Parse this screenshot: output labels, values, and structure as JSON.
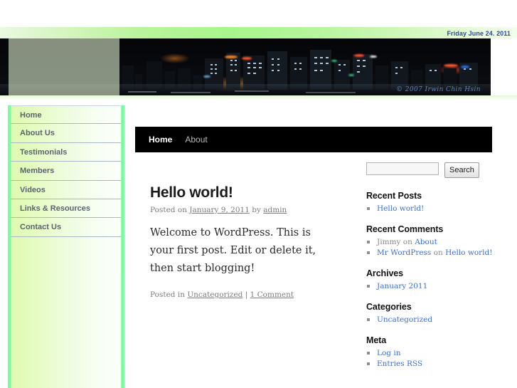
{
  "date_bar": {
    "text": "Friday June 24. 2011"
  },
  "header": {
    "watermark": "© 2007 Irwin Chin Hsin",
    "image_alt": "night-city-skyline"
  },
  "sidebar_menu": {
    "items": [
      {
        "label": "Home"
      },
      {
        "label": "About Us"
      },
      {
        "label": "Testimonials"
      },
      {
        "label": "Members"
      },
      {
        "label": "Videos"
      },
      {
        "label": "Links & Resources"
      },
      {
        "label": "Contact Us"
      }
    ]
  },
  "topnav": {
    "items": [
      {
        "label": "Home",
        "active": true
      },
      {
        "label": "About",
        "active": false
      }
    ]
  },
  "post": {
    "title": "Hello world!",
    "meta_prefix": "Posted on ",
    "meta_date": "January 9, 2011",
    "meta_by": " by ",
    "meta_author": "admin",
    "body": "Welcome to WordPress. This is your first post. Edit or delete it, then start blogging!",
    "footer_prefix": "Posted in ",
    "footer_category": "Uncategorized",
    "footer_sep": " | ",
    "footer_comments": "1 Comment"
  },
  "search": {
    "value": "",
    "placeholder": "",
    "button_label": "Search"
  },
  "widgets": [
    {
      "title": "Recent Posts",
      "items": [
        {
          "prefix": "",
          "link": "Hello world!",
          "middle": "",
          "link2": ""
        }
      ]
    },
    {
      "title": "Recent Comments",
      "items": [
        {
          "prefix": "Jimmy",
          "link": "",
          "middle": " on ",
          "link2": "About"
        },
        {
          "prefix": "",
          "link": "Mr WordPress",
          "middle": " on ",
          "link2": "Hello world!"
        }
      ]
    },
    {
      "title": "Archives",
      "items": [
        {
          "prefix": "",
          "link": "January 2011",
          "middle": "",
          "link2": ""
        }
      ]
    },
    {
      "title": "Categories",
      "items": [
        {
          "prefix": "",
          "link": "Uncategorized",
          "middle": "",
          "link2": ""
        }
      ]
    },
    {
      "title": "Meta",
      "items": [
        {
          "prefix": "",
          "link": "Log in",
          "middle": "",
          "link2": ""
        },
        {
          "prefix": "",
          "link": "Entries RSS",
          "middle": "",
          "link2": ""
        }
      ]
    }
  ],
  "colors": {
    "green_rail": "#7dfaa0",
    "menu_text": "#5b6470",
    "link_blue": "#3b6fd4",
    "date_blue": "#2b4a9c",
    "nav_black": "#000000"
  }
}
